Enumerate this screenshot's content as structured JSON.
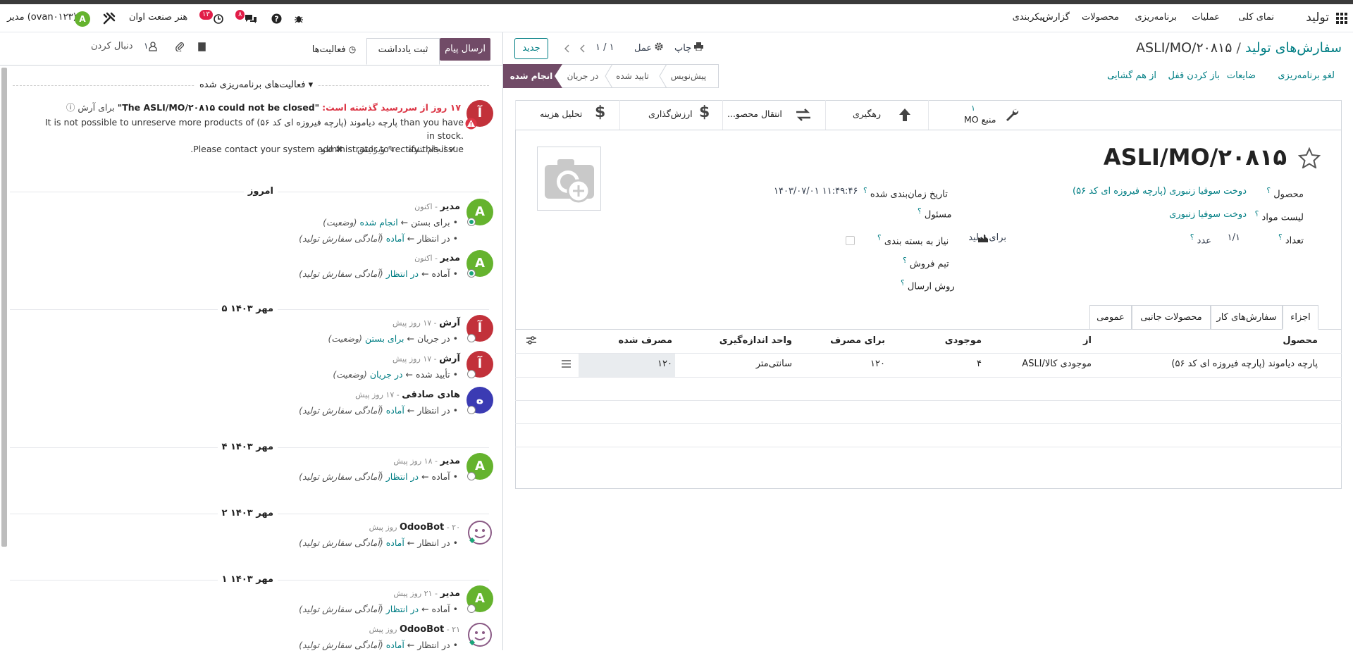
{
  "navbar": {
    "apps_icon": "grid-icon",
    "app_name": "تولید",
    "menu": [
      "نمای کلی",
      "عملیات",
      "برنامه‌ریزی",
      "محصولات",
      "گزارش",
      "پیکربندی"
    ],
    "company": "هنر صنعت اوان",
    "activity_count": "۱۳",
    "messages_count": "۸",
    "user_initial": "A",
    "user_label": "مدیر (ovan۰۱۲۳)"
  },
  "control": {
    "breadcrumb_parent": "سفارش‌های تولید",
    "breadcrumb_sep": "/",
    "breadcrumb_current": "ASLI/MO/۲۰۸۱۵",
    "print_label": "چاپ",
    "action_label": "عمل",
    "pager": "۱ / ۱",
    "new_label": "جدید"
  },
  "action_buttons": [
    "لغو برنامه‌ریزی",
    "ضایعات",
    "باز کردن قفل",
    "از هم گشایی"
  ],
  "statusbar": [
    "پیش‌نویس",
    "تایید شده",
    "در جریان",
    "انجام شده"
  ],
  "statusbar_active": 3,
  "smart_buttons": {
    "source_count": "۱",
    "source_label": "منبع MO",
    "traceability": "رهگیری",
    "transfers": "انتقال محصو...",
    "valuation": "ارزش‌گذاری",
    "cost_analysis": "تحلیل هزینه"
  },
  "form": {
    "title": "ASLI/MO/۲۰۸۱۵",
    "product_label": "محصول",
    "product_value": "دوخت سوفیا زنبوری (پارچه فیروزه ای کد ۵۶)",
    "bom_label": "لیست مواد",
    "bom_value": "دوخت سوفیا زنبوری",
    "qty_label": "تعداد",
    "qty_value": "۱/۱",
    "qty_unit": "عدد",
    "to_produce": "برای تولید",
    "scheduled_label": "تاریخ زمان‌بندی شده",
    "scheduled_value": "۱۴۰۳/۰۷/۰۱ ۱۱:۴۹:۴۶",
    "responsible_label": "مسئول",
    "packaging_label": "نیاز به بسته بندی",
    "sales_team_label": "تیم فروش",
    "shipping_label": "روش ارسال",
    "help": "؟"
  },
  "tabs": [
    "اجزاء",
    "سفارش‌های کار",
    "محصولات جانبی",
    "عمومی"
  ],
  "table": {
    "headers": [
      "محصول",
      "از",
      "موجودی",
      "برای مصرف",
      "واحد اندازه‌گیری",
      "مصرف شده"
    ],
    "rows": [
      {
        "product": "پارچه دیاموند (پارچه فیروزه ای کد ۵۶)",
        "from": "ASLI/موجودی کالا",
        "stock": "۴",
        "to_consume": "۱۲۰",
        "uom": "سانتی‌متر",
        "consumed": "۱۲۰"
      }
    ]
  },
  "chatter": {
    "send_message": "ارسال پیام",
    "log_note": "ثبت یادداشت",
    "activities": "فعالیت‌ها",
    "follower_count": "۱",
    "follow": "دنبال کردن",
    "planned_activities": "فعالیت‌های برنامه‌ریزی شده",
    "activity": {
      "overdue": "۱۷ روز از سررسید گذشته است:",
      "summary": "\"The ASLI/MO/۲۰۸۱۵ could not be closed\"",
      "for": "برای آرش",
      "note1": "It is not possible to unreserve more products of پارچه دیاموند (پارچه فیروزه ای کد ۵۶) than you have in stock.",
      "note2": ".Please contact your system administrator to rectify this issue",
      "done": "انجام شده",
      "edit": "ویرایش",
      "cancel": "لغو",
      "avatar": "آ"
    },
    "messages": [
      {
        "date": "امروز"
      },
      {
        "author": "مدیر",
        "time": "- اکنون",
        "avatar": "A",
        "color": "#65b32e",
        "lines": [
          [
            "برای بستن",
            "انجام شده",
            "(وضعیت)"
          ],
          [
            "در انتظار",
            "آماده",
            "(آمادگی سفارش تولید)"
          ]
        ]
      },
      {
        "author": "مدیر",
        "time": "- اکنون",
        "avatar": "A",
        "color": "#65b32e",
        "lines": [
          [
            "آماده",
            "در انتظار",
            "(آمادگی سفارش تولید)"
          ]
        ]
      },
      {
        "date": "۵ مهر ۱۴۰۳"
      },
      {
        "author": "آرش",
        "time": "- ۱۷ روز پیش",
        "avatar": "آ",
        "color": "#c2313a",
        "lines": [
          [
            "در جریان",
            "برای بستن",
            "(وضعیت)"
          ]
        ]
      },
      {
        "author": "آرش",
        "time": "- ۱۷ روز پیش",
        "avatar": "آ",
        "color": "#c2313a",
        "lines": [
          [
            "تأیید شده",
            "در جریان",
            "(وضعیت)"
          ]
        ]
      },
      {
        "author": "هادی صادقی",
        "time": "- ۱۷ روز پیش",
        "avatar": "ه",
        "color": "#3b3bb3",
        "lines": [
          [
            "در انتظار",
            "آماده",
            "(آمادگی سفارش تولید)"
          ]
        ]
      },
      {
        "date": "۴ مهر ۱۴۰۳"
      },
      {
        "author": "مدیر",
        "time": "- ۱۸ روز پیش",
        "avatar": "A",
        "color": "#65b32e",
        "lines": [
          [
            "آماده",
            "در انتظار",
            "(آمادگی سفارش تولید)"
          ]
        ]
      },
      {
        "date": "۲ مهر ۱۴۰۳"
      },
      {
        "author": "OdooBot",
        "time": "- ۲۰ روز پیش",
        "avatar": "bot",
        "color": "#ffffff",
        "lines": [
          [
            "در انتظار",
            "آماده",
            "(آمادگی سفارش تولید)"
          ]
        ]
      },
      {
        "date": "۱ مهر ۱۴۰۳"
      },
      {
        "author": "مدیر",
        "time": "- ۲۱ روز پیش",
        "avatar": "A",
        "color": "#65b32e",
        "lines": [
          [
            "آماده",
            "در انتظار",
            "(آمادگی سفارش تولید)"
          ]
        ]
      },
      {
        "author": "OdooBot",
        "time": "- ۲۱ روز پیش",
        "avatar": "bot",
        "color": "#ffffff",
        "lines": [
          [
            "در انتظار",
            "آماده",
            "(آمادگی سفارش تولید)"
          ]
        ]
      }
    ]
  }
}
